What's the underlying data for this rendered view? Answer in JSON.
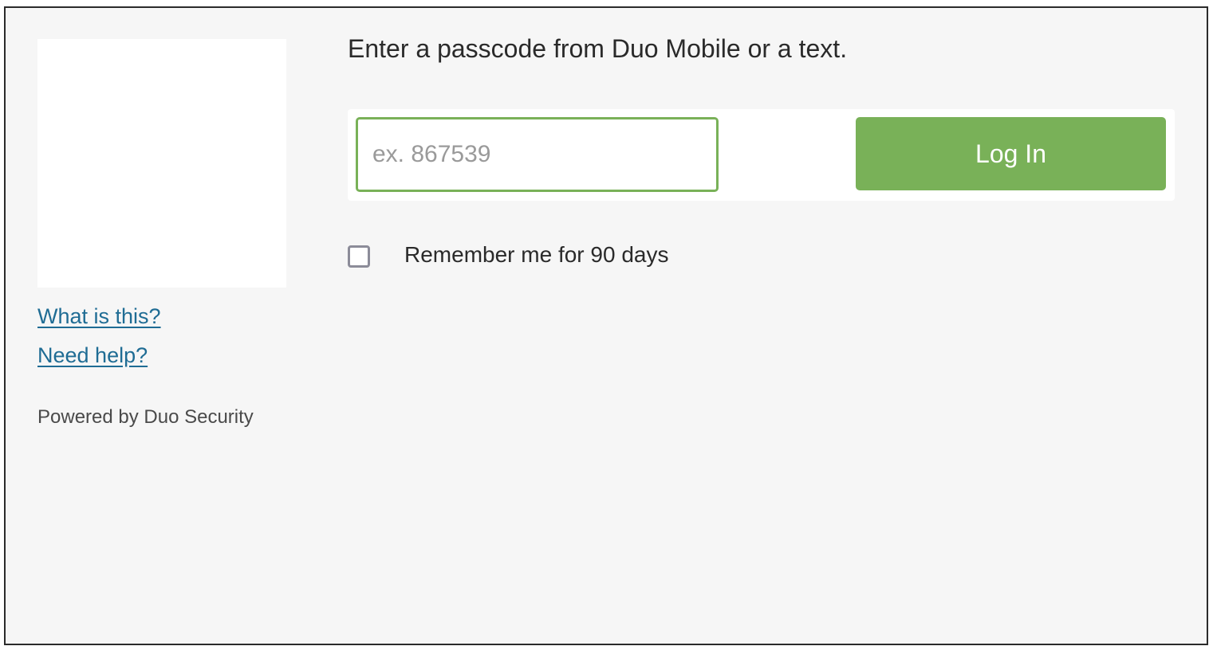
{
  "sidebar": {
    "links": [
      {
        "label": "What is this?"
      },
      {
        "label": "Need help?"
      }
    ],
    "powered_by": "Powered by Duo Security"
  },
  "main": {
    "prompt": "Enter a passcode from Duo Mobile or a text.",
    "passcode": {
      "placeholder": "ex. 867539",
      "value": ""
    },
    "login_label": "Log In",
    "remember": {
      "label": "Remember me for 90 days",
      "checked": false
    }
  },
  "colors": {
    "accent": "#79b158",
    "link": "#1f6c94",
    "background": "#f6f6f6"
  }
}
